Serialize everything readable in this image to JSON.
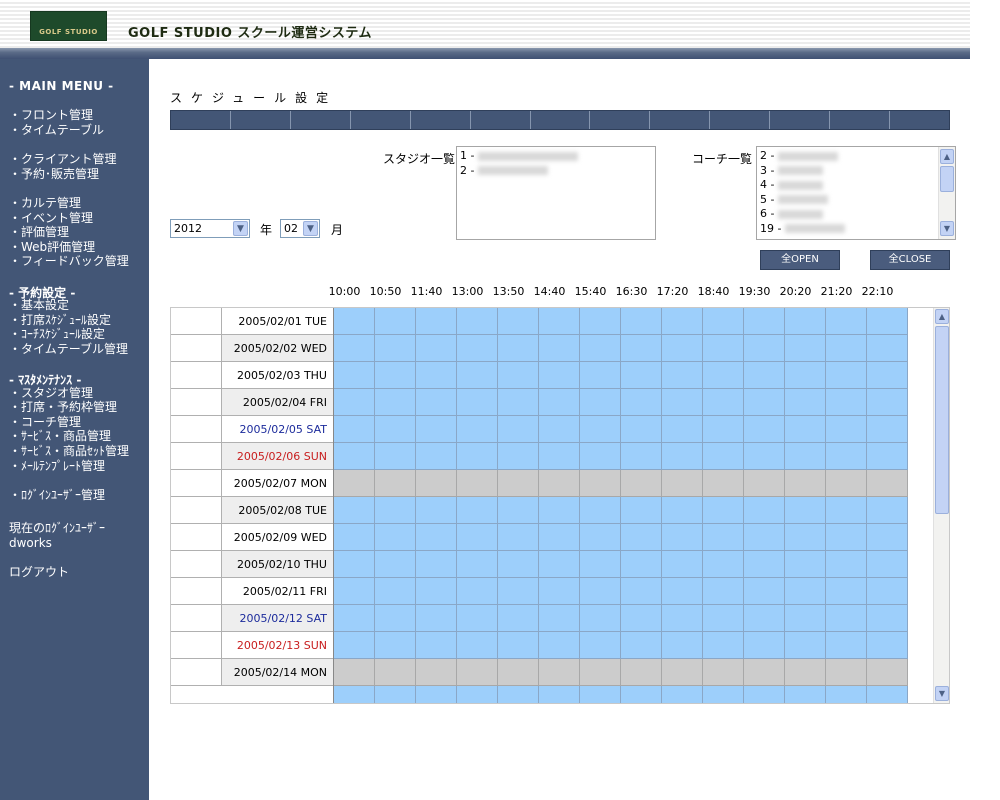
{
  "app": {
    "logo_text": "GOLF STUDIO",
    "title": "GOLF STUDIO スクール運営システム"
  },
  "sidebar": {
    "main_menu": "- MAIN MENU -",
    "items": [
      "・フロント管理",
      "・タイムテーブル",
      "・クライアント管理",
      "・予約･販売管理",
      "・カルテ管理",
      "・イベント管理",
      "・評価管理",
      "・Web評価管理",
      "・フィードバック管理",
      "・基本設定",
      "・打席ｽｹｼﾞｭｰﾙ設定",
      "・ｺｰﾁｽｹｼﾞｭｰﾙ設定",
      "・タイムテーブル管理",
      "・スタジオ管理",
      "・打席・予約枠管理",
      "・コーチ管理",
      "・ｻｰﾋﾞｽ・商品管理",
      "・ｻｰﾋﾞｽ・商品ｾｯﾄ管理",
      "・ﾒｰﾙﾃﾝﾌﾟﾚｰﾄ管理",
      "・ﾛｸﾞｲﾝﾕｰｻﾞｰ管理"
    ],
    "section_yoyaku": "- 予約設定 -",
    "section_master": "- ﾏｽﾀﾒﾝﾃﾅﾝｽ -",
    "login_user_label": "現在のﾛｸﾞｲﾝﾕｰｻﾞｰ",
    "login_user_name": "dworks",
    "logout": "ログアウト"
  },
  "main": {
    "page_title": "スケジュール設定",
    "studio_label": "スタジオ一覧",
    "studio_items": [
      "1 -",
      "2 -"
    ],
    "coach_label": "コーチ一覧",
    "coach_items": [
      "2 -",
      "3 -",
      "4 -",
      "5 -",
      "6 -",
      "19 -"
    ],
    "year_value": "2012",
    "year_label": "年",
    "month_value": "02",
    "month_label": "月",
    "open_all": "全OPEN",
    "close_all": "全CLOSE",
    "times": [
      "10:00",
      "10:50",
      "11:40",
      "13:00",
      "13:50",
      "14:40",
      "15:40",
      "16:30",
      "17:20",
      "18:40",
      "19:30",
      "20:20",
      "21:20",
      "22:10"
    ],
    "rows": [
      {
        "date": "2005/02/01 TUE",
        "kind": "weekday",
        "gray": false
      },
      {
        "date": "2005/02/02 WED",
        "kind": "weekday",
        "gray": false
      },
      {
        "date": "2005/02/03 THU",
        "kind": "weekday",
        "gray": false
      },
      {
        "date": "2005/02/04 FRI",
        "kind": "weekday",
        "gray": false
      },
      {
        "date": "2005/02/05 SAT",
        "kind": "sat",
        "gray": false
      },
      {
        "date": "2005/02/06 SUN",
        "kind": "sun",
        "gray": false
      },
      {
        "date": "2005/02/07 MON",
        "kind": "weekday",
        "gray": true
      },
      {
        "date": "2005/02/08 TUE",
        "kind": "weekday",
        "gray": false
      },
      {
        "date": "2005/02/09 WED",
        "kind": "weekday",
        "gray": false
      },
      {
        "date": "2005/02/10 THU",
        "kind": "weekday",
        "gray": false
      },
      {
        "date": "2005/02/11 FRI",
        "kind": "weekday",
        "gray": false
      },
      {
        "date": "2005/02/12 SAT",
        "kind": "sat",
        "gray": false
      },
      {
        "date": "2005/02/13 SUN",
        "kind": "sun",
        "gray": false
      },
      {
        "date": "2005/02/14 MON",
        "kind": "weekday",
        "gray": true
      }
    ]
  },
  "colors": {
    "sidebar_bg": "#435676",
    "cell_open": "#9dcffb",
    "cell_closed": "#cccccc",
    "saturday": "#1d2c9c",
    "sunday": "#c81e1e"
  }
}
